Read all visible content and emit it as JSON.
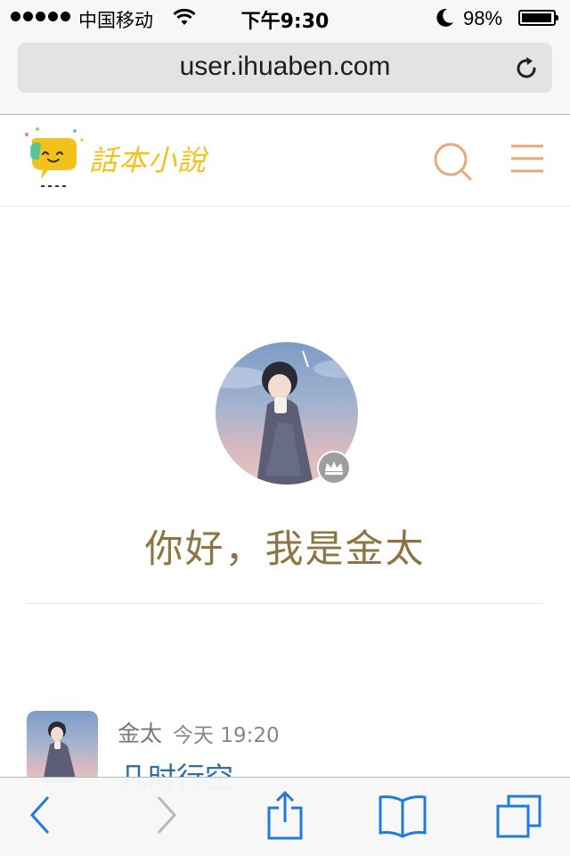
{
  "status_bar": {
    "carrier": "中国移动",
    "time": "下午9:30",
    "battery": "98%",
    "battery_level": 0.98
  },
  "browser": {
    "url": "user.ihuaben.com"
  },
  "site": {
    "logo_text": "話本小說"
  },
  "profile": {
    "greeting": "你好，我是金太"
  },
  "post": {
    "author": "金太",
    "time": "今天 19:20",
    "title": "几时行空"
  },
  "colors": {
    "accent": "#e9a77c",
    "greeting": "#8d7440",
    "link": "#2f6fa6",
    "ios_blue": "#1f7be0",
    "logo_yellow": "#f2c21b"
  },
  "icons": [
    "wifi-icon",
    "moon-icon",
    "battery-icon",
    "reload-icon",
    "search-icon",
    "menu-icon",
    "crown-icon",
    "back-icon",
    "forward-icon",
    "share-icon",
    "bookmarks-icon",
    "tabs-icon"
  ]
}
